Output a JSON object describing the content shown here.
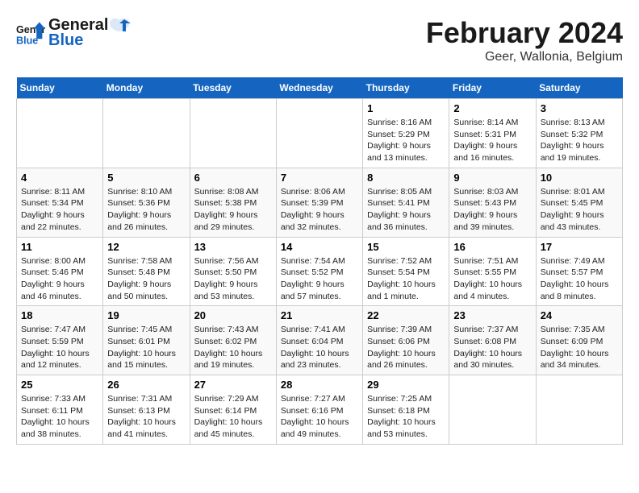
{
  "logo": {
    "line1": "General",
    "line2": "Blue"
  },
  "title": "February 2024",
  "subtitle": "Geer, Wallonia, Belgium",
  "days_of_week": [
    "Sunday",
    "Monday",
    "Tuesday",
    "Wednesday",
    "Thursday",
    "Friday",
    "Saturday"
  ],
  "weeks": [
    [
      {
        "day": "",
        "info": ""
      },
      {
        "day": "",
        "info": ""
      },
      {
        "day": "",
        "info": ""
      },
      {
        "day": "",
        "info": ""
      },
      {
        "day": "1",
        "info": "Sunrise: 8:16 AM\nSunset: 5:29 PM\nDaylight: 9 hours\nand 13 minutes."
      },
      {
        "day": "2",
        "info": "Sunrise: 8:14 AM\nSunset: 5:31 PM\nDaylight: 9 hours\nand 16 minutes."
      },
      {
        "day": "3",
        "info": "Sunrise: 8:13 AM\nSunset: 5:32 PM\nDaylight: 9 hours\nand 19 minutes."
      }
    ],
    [
      {
        "day": "4",
        "info": "Sunrise: 8:11 AM\nSunset: 5:34 PM\nDaylight: 9 hours\nand 22 minutes."
      },
      {
        "day": "5",
        "info": "Sunrise: 8:10 AM\nSunset: 5:36 PM\nDaylight: 9 hours\nand 26 minutes."
      },
      {
        "day": "6",
        "info": "Sunrise: 8:08 AM\nSunset: 5:38 PM\nDaylight: 9 hours\nand 29 minutes."
      },
      {
        "day": "7",
        "info": "Sunrise: 8:06 AM\nSunset: 5:39 PM\nDaylight: 9 hours\nand 32 minutes."
      },
      {
        "day": "8",
        "info": "Sunrise: 8:05 AM\nSunset: 5:41 PM\nDaylight: 9 hours\nand 36 minutes."
      },
      {
        "day": "9",
        "info": "Sunrise: 8:03 AM\nSunset: 5:43 PM\nDaylight: 9 hours\nand 39 minutes."
      },
      {
        "day": "10",
        "info": "Sunrise: 8:01 AM\nSunset: 5:45 PM\nDaylight: 9 hours\nand 43 minutes."
      }
    ],
    [
      {
        "day": "11",
        "info": "Sunrise: 8:00 AM\nSunset: 5:46 PM\nDaylight: 9 hours\nand 46 minutes."
      },
      {
        "day": "12",
        "info": "Sunrise: 7:58 AM\nSunset: 5:48 PM\nDaylight: 9 hours\nand 50 minutes."
      },
      {
        "day": "13",
        "info": "Sunrise: 7:56 AM\nSunset: 5:50 PM\nDaylight: 9 hours\nand 53 minutes."
      },
      {
        "day": "14",
        "info": "Sunrise: 7:54 AM\nSunset: 5:52 PM\nDaylight: 9 hours\nand 57 minutes."
      },
      {
        "day": "15",
        "info": "Sunrise: 7:52 AM\nSunset: 5:54 PM\nDaylight: 10 hours\nand 1 minute."
      },
      {
        "day": "16",
        "info": "Sunrise: 7:51 AM\nSunset: 5:55 PM\nDaylight: 10 hours\nand 4 minutes."
      },
      {
        "day": "17",
        "info": "Sunrise: 7:49 AM\nSunset: 5:57 PM\nDaylight: 10 hours\nand 8 minutes."
      }
    ],
    [
      {
        "day": "18",
        "info": "Sunrise: 7:47 AM\nSunset: 5:59 PM\nDaylight: 10 hours\nand 12 minutes."
      },
      {
        "day": "19",
        "info": "Sunrise: 7:45 AM\nSunset: 6:01 PM\nDaylight: 10 hours\nand 15 minutes."
      },
      {
        "day": "20",
        "info": "Sunrise: 7:43 AM\nSunset: 6:02 PM\nDaylight: 10 hours\nand 19 minutes."
      },
      {
        "day": "21",
        "info": "Sunrise: 7:41 AM\nSunset: 6:04 PM\nDaylight: 10 hours\nand 23 minutes."
      },
      {
        "day": "22",
        "info": "Sunrise: 7:39 AM\nSunset: 6:06 PM\nDaylight: 10 hours\nand 26 minutes."
      },
      {
        "day": "23",
        "info": "Sunrise: 7:37 AM\nSunset: 6:08 PM\nDaylight: 10 hours\nand 30 minutes."
      },
      {
        "day": "24",
        "info": "Sunrise: 7:35 AM\nSunset: 6:09 PM\nDaylight: 10 hours\nand 34 minutes."
      }
    ],
    [
      {
        "day": "25",
        "info": "Sunrise: 7:33 AM\nSunset: 6:11 PM\nDaylight: 10 hours\nand 38 minutes."
      },
      {
        "day": "26",
        "info": "Sunrise: 7:31 AM\nSunset: 6:13 PM\nDaylight: 10 hours\nand 41 minutes."
      },
      {
        "day": "27",
        "info": "Sunrise: 7:29 AM\nSunset: 6:14 PM\nDaylight: 10 hours\nand 45 minutes."
      },
      {
        "day": "28",
        "info": "Sunrise: 7:27 AM\nSunset: 6:16 PM\nDaylight: 10 hours\nand 49 minutes."
      },
      {
        "day": "29",
        "info": "Sunrise: 7:25 AM\nSunset: 6:18 PM\nDaylight: 10 hours\nand 53 minutes."
      },
      {
        "day": "",
        "info": ""
      },
      {
        "day": "",
        "info": ""
      }
    ]
  ]
}
